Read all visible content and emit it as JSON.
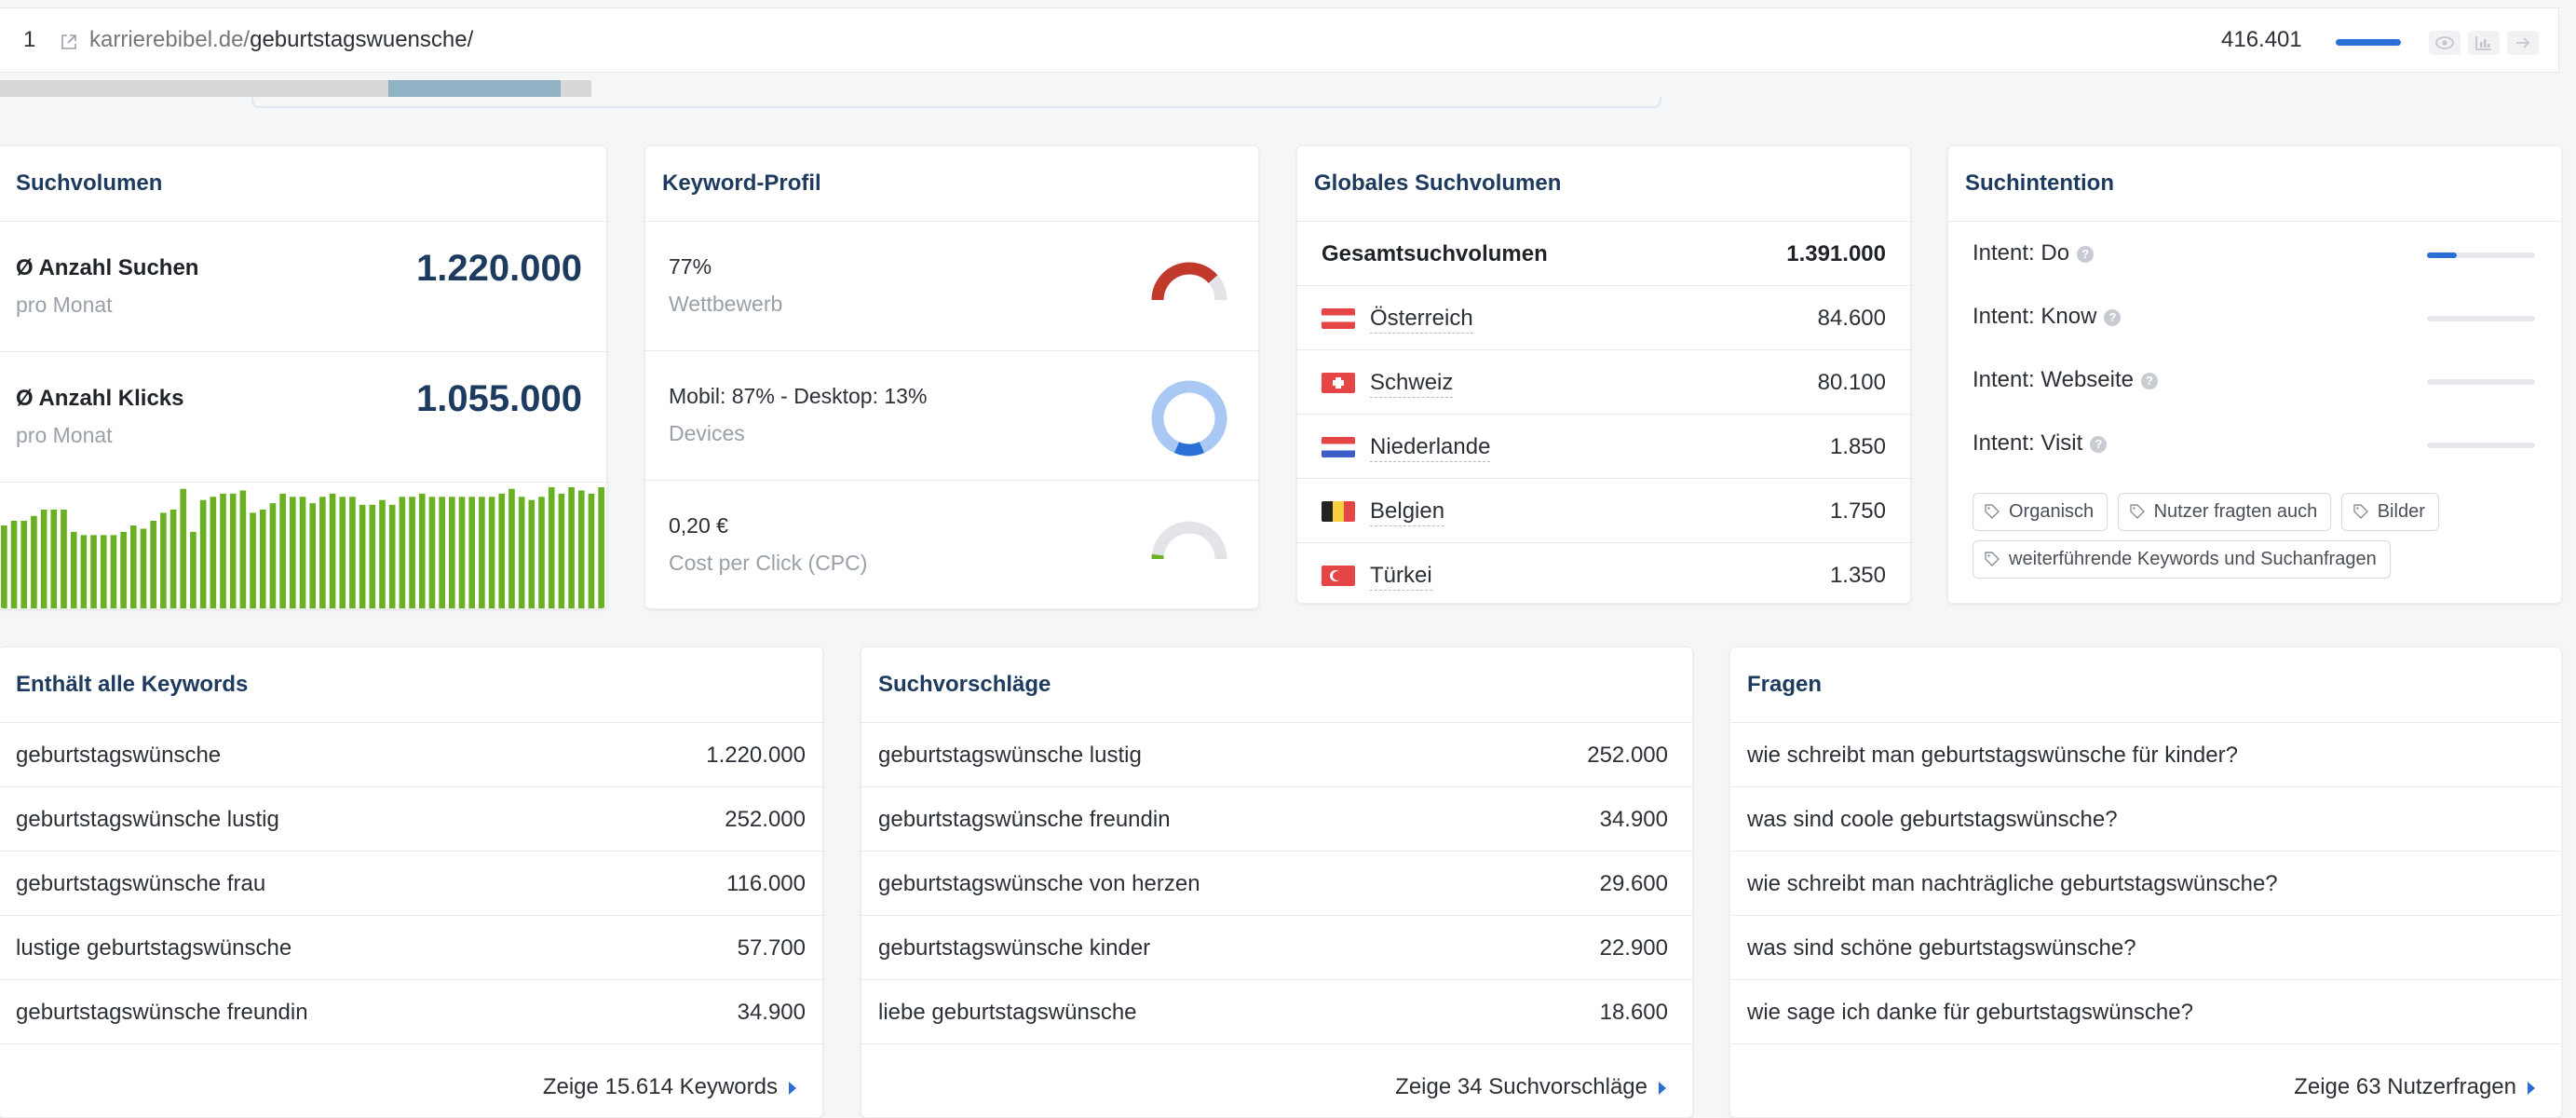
{
  "top": {
    "rank": "1",
    "url_domain": "karrierebibel.de/",
    "url_path": "geburtstagswuensche/",
    "traffic": "416.401",
    "traffic_fill": 0.9
  },
  "suchvolumen": {
    "title": "Suchvolumen",
    "rows": [
      {
        "label": "Ø Anzahl Suchen",
        "sub": "pro Monat",
        "value": "1.220.000"
      },
      {
        "label": "Ø Anzahl Klicks",
        "sub": "pro Monat",
        "value": "1.055.000"
      }
    ],
    "trend_values": [
      52,
      55,
      55,
      58,
      62,
      62,
      62,
      48,
      46,
      46,
      46,
      46,
      48,
      52,
      50,
      55,
      60,
      62,
      75,
      48,
      68,
      70,
      72,
      72,
      74,
      60,
      62,
      66,
      72,
      70,
      70,
      66,
      70,
      72,
      70,
      70,
      65,
      65,
      68,
      65,
      70,
      70,
      72,
      70,
      70,
      70,
      70,
      70,
      70,
      70,
      72,
      75,
      70,
      68,
      70,
      76,
      72,
      76,
      74,
      72,
      76
    ],
    "trend_color": "#6ab023"
  },
  "keyword_profil": {
    "title": "Keyword-Profil",
    "rows": [
      {
        "value": "77%",
        "sub": "Wettbewerb",
        "gauge": 0.77,
        "color": "#c0392b"
      },
      {
        "value": "Mobil: 87% - Desktop: 13%",
        "sub": "Devices",
        "mobile": 0.87,
        "color": "#a9c8f3",
        "color2": "#2a6fd6"
      },
      {
        "value": "0,20 €",
        "sub": "Cost per Click (CPC)",
        "gauge": 0.04,
        "color": "#6ab023"
      }
    ]
  },
  "global": {
    "title": "Globales Suchvolumen",
    "total_label": "Gesamtsuchvolumen",
    "total_value": "1.391.000",
    "countries": [
      {
        "name": "Österreich",
        "value": "84.600",
        "flag": "at"
      },
      {
        "name": "Schweiz",
        "value": "80.100",
        "flag": "ch"
      },
      {
        "name": "Niederlande",
        "value": "1.850",
        "flag": "nl"
      },
      {
        "name": "Belgien",
        "value": "1.750",
        "flag": "be"
      },
      {
        "name": "Türkei",
        "value": "1.350",
        "flag": "tr"
      }
    ]
  },
  "intent": {
    "title": "Suchintention",
    "rows": [
      {
        "label": "Intent: Do",
        "level": 0.28
      },
      {
        "label": "Intent: Know",
        "level": 0
      },
      {
        "label": "Intent: Webseite",
        "level": 0
      },
      {
        "label": "Intent: Visit",
        "level": 0
      }
    ],
    "chips": [
      "Organisch",
      "Nutzer fragten auch",
      "Bilder",
      "weiterführende Keywords und Suchanfragen"
    ]
  },
  "keywords": {
    "title": "Enthält alle Keywords",
    "rows": [
      {
        "k": "geburtstagswünsche",
        "v": "1.220.000"
      },
      {
        "k": "geburtstagswünsche lustig",
        "v": "252.000"
      },
      {
        "k": "geburtstagswünsche frau",
        "v": "116.000"
      },
      {
        "k": "lustige geburtstagswünsche",
        "v": "57.700"
      },
      {
        "k": "geburtstagswünsche freundin",
        "v": "34.900"
      }
    ],
    "more": "Zeige 15.614 Keywords"
  },
  "vorschlaege": {
    "title": "Suchvorschläge",
    "rows": [
      {
        "k": "geburtstagswünsche lustig",
        "v": "252.000"
      },
      {
        "k": "geburtstagswünsche freundin",
        "v": "34.900"
      },
      {
        "k": "geburtstagswünsche von herzen",
        "v": "29.600"
      },
      {
        "k": "geburtstagswünsche kinder",
        "v": "22.900"
      },
      {
        "k": "liebe geburtstagswünsche",
        "v": "18.600"
      }
    ],
    "more": "Zeige 34 Suchvorschläge"
  },
  "fragen": {
    "title": "Fragen",
    "rows": [
      {
        "k": "wie schreibt man geburtstagswünsche für kinder?"
      },
      {
        "k": "was sind coole geburtstagswünsche?"
      },
      {
        "k": "wie schreibt man nachträgliche geburtstagswünsche?"
      },
      {
        "k": "was sind schöne geburtstagswünsche?"
      },
      {
        "k": "wie sage ich danke für geburtstagswünsche?"
      }
    ],
    "more": "Zeige 63 Nutzerfragen"
  }
}
